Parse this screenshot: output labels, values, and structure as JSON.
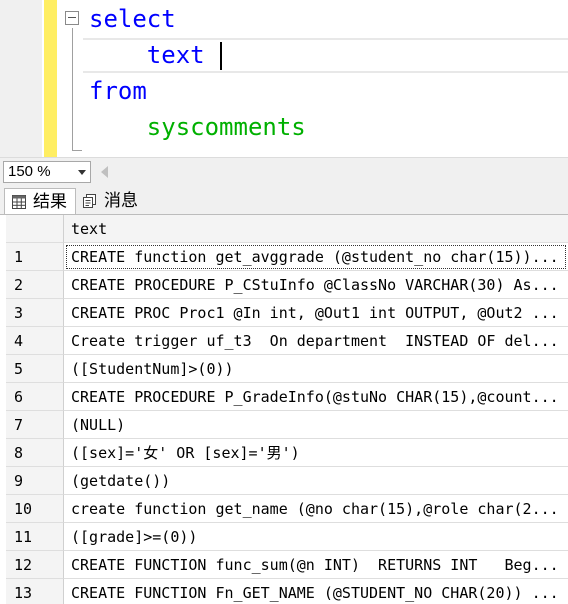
{
  "editor": {
    "lines": [
      {
        "text": "select",
        "class": "kw"
      },
      {
        "text": "    text",
        "class": "kw"
      },
      {
        "text": "from",
        "class": "kw"
      },
      {
        "text": "    syscomments",
        "class": "sys"
      }
    ]
  },
  "zoom": {
    "value": "150 %"
  },
  "tabs": {
    "results": "结果",
    "messages": "消息"
  },
  "grid": {
    "column_header": "text",
    "rows": [
      {
        "num": "1",
        "text": "CREATE function get_avggrade (@student_no char(15))..."
      },
      {
        "num": "2",
        "text": "CREATE PROCEDURE P_CStuInfo @ClassNo VARCHAR(30) As..."
      },
      {
        "num": "3",
        "text": "CREATE PROC Proc1 @In int, @Out1 int OUTPUT, @Out2 ..."
      },
      {
        "num": "4",
        "text": "Create trigger uf_t3  On department  INSTEAD OF del..."
      },
      {
        "num": "5",
        "text": "([StudentNum]>(0))"
      },
      {
        "num": "6",
        "text": "CREATE PROCEDURE P_GradeInfo(@stuNo CHAR(15),@count..."
      },
      {
        "num": "7",
        "text": "(NULL)"
      },
      {
        "num": "8",
        "text": "([sex]='女' OR [sex]='男')"
      },
      {
        "num": "9",
        "text": "(getdate())"
      },
      {
        "num": "10",
        "text": "create function get_name (@no char(15),@role char(2..."
      },
      {
        "num": "11",
        "text": "([grade]>=(0))"
      },
      {
        "num": "12",
        "text": "CREATE FUNCTION func_sum(@n INT)  RETURNS INT   Beg..."
      },
      {
        "num": "13",
        "text": "CREATE FUNCTION Fn_GET_NAME (@STUDENT_NO CHAR(20)) ..."
      }
    ]
  },
  "colors": {
    "keyword": "#0000ff",
    "system_object": "#00b000",
    "modified_bar": "#ffee62"
  }
}
